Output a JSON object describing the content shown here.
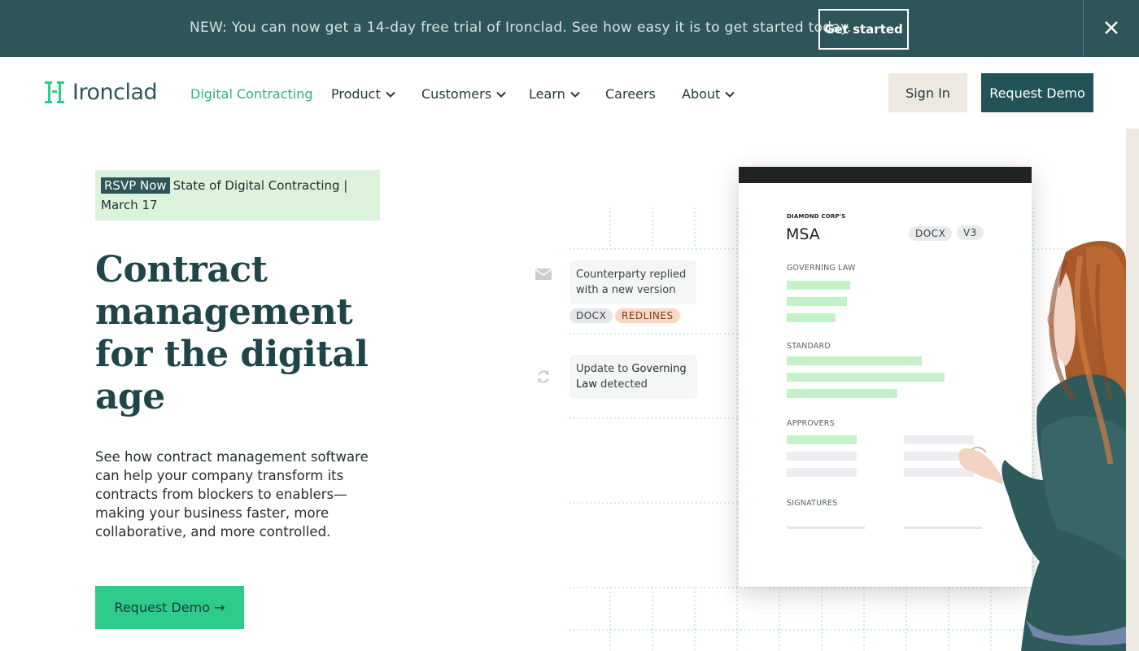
{
  "banner": {
    "text": "NEW: You can now get a 14-day free trial of Ironclad. See how easy it is to get started today.",
    "cta": "Get started",
    "close_icon": "close-icon"
  },
  "nav": {
    "logo_text": "Ironclad",
    "items": [
      {
        "label": "Digital Contracting",
        "active": true
      },
      {
        "label": "Product",
        "dropdown": true
      },
      {
        "label": "Customers",
        "dropdown": true
      },
      {
        "label": "Learn",
        "dropdown": true
      },
      {
        "label": "Careers"
      },
      {
        "label": "About",
        "dropdown": true
      }
    ],
    "sign_in": "Sign In",
    "request_demo": "Request Demo"
  },
  "hero": {
    "rsvp_tag": "RSVP Now",
    "rsvp_text": "State of Digital Contracting | March 17",
    "title_lines": [
      "Contract",
      "management",
      "for the digital",
      "age"
    ],
    "description": "See how contract management software can help your company transform its contracts from blockers to enablers—making your business faster, more collaborative, and more controlled.",
    "cta": "Request Demo →"
  },
  "illustration": {
    "notif1": {
      "text": "Counterparty replied with a new version",
      "icon": "mail-icon"
    },
    "chips1": [
      "DOCX",
      "REDLINES"
    ],
    "notif2": {
      "prefix": "Update to ",
      "highlight": "Governing Law",
      "suffix": " detected",
      "icon": "sync-icon"
    },
    "doc": {
      "company": "DIAMOND CORP'S",
      "title": "MSA",
      "chips": [
        "DOCX",
        "V3"
      ],
      "sections": [
        "GOVERNING LAW",
        "STANDARD",
        "APPROVERS",
        "SIGNATURES"
      ]
    }
  },
  "colors": {
    "banner_bg": "#2e5559",
    "accent_green": "#2dcc8a",
    "active_nav": "#29b57a",
    "dark_teal": "#225457"
  }
}
